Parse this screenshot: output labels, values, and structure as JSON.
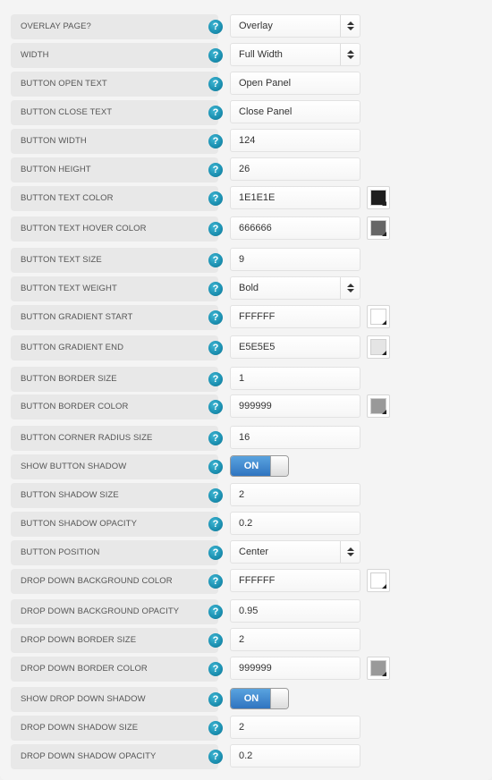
{
  "settings": {
    "rows": [
      {
        "label": "OVERLAY PAGE?",
        "type": "select",
        "value": "Overlay"
      },
      {
        "label": "WIDTH",
        "type": "select",
        "value": "Full Width"
      },
      {
        "label": "BUTTON OPEN TEXT",
        "type": "text",
        "value": "Open Panel"
      },
      {
        "label": "BUTTON CLOSE TEXT",
        "type": "text",
        "value": "Close Panel"
      },
      {
        "label": "BUTTON WIDTH",
        "type": "text",
        "value": "124"
      },
      {
        "label": "BUTTON HEIGHT",
        "type": "text",
        "value": "26"
      },
      {
        "label": "BUTTON TEXT COLOR",
        "type": "color",
        "value": "1E1E1E",
        "swatch": "#1e1e1e"
      },
      {
        "label": "BUTTON TEXT HOVER COLOR",
        "type": "color",
        "value": "666666",
        "swatch": "#666666"
      },
      {
        "label": "BUTTON TEXT SIZE",
        "type": "text",
        "value": "9"
      },
      {
        "label": "BUTTON TEXT WEIGHT",
        "type": "select",
        "value": "Bold"
      },
      {
        "label": "BUTTON GRADIENT START",
        "type": "color",
        "value": "FFFFFF",
        "swatch": "#ffffff"
      },
      {
        "label": "BUTTON GRADIENT END",
        "type": "color",
        "value": "E5E5E5",
        "swatch": "#e5e5e5"
      },
      {
        "label": "BUTTON BORDER SIZE",
        "type": "text",
        "value": "1"
      },
      {
        "label": "BUTTON BORDER COLOR",
        "type": "color",
        "value": "999999",
        "swatch": "#999999"
      },
      {
        "label": "BUTTON CORNER RADIUS SIZE",
        "type": "text",
        "value": "16"
      },
      {
        "label": "SHOW BUTTON SHADOW",
        "type": "toggle",
        "value": "ON"
      },
      {
        "label": "BUTTON SHADOW SIZE",
        "type": "text",
        "value": "2"
      },
      {
        "label": "BUTTON SHADOW OPACITY",
        "type": "text",
        "value": "0.2"
      },
      {
        "label": "BUTTON POSITION",
        "type": "select",
        "value": "Center"
      },
      {
        "label": "DROP DOWN BACKGROUND COLOR",
        "type": "color",
        "value": "FFFFFF",
        "swatch": "#ffffff"
      },
      {
        "label": "DROP DOWN BACKGROUND OPACITY",
        "type": "text",
        "value": "0.95"
      },
      {
        "label": "DROP DOWN BORDER SIZE",
        "type": "text",
        "value": "2"
      },
      {
        "label": "DROP DOWN BORDER COLOR",
        "type": "color",
        "value": "999999",
        "swatch": "#999999"
      },
      {
        "label": "SHOW DROP DOWN SHADOW",
        "type": "toggle",
        "value": "ON"
      },
      {
        "label": "DROP DOWN SHADOW SIZE",
        "type": "text",
        "value": "2"
      },
      {
        "label": "DROP DOWN SHADOW OPACITY",
        "type": "text",
        "value": "0.2"
      }
    ],
    "help_icon": "?",
    "colors": {
      "help_icon": "#1b8fb0",
      "toggle_on": "#3a82cc",
      "label_bg": "#e8e8e8"
    }
  }
}
